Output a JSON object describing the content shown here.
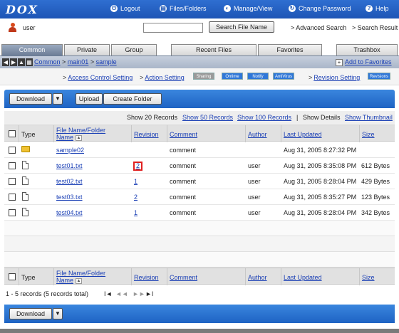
{
  "app": {
    "logo": "DOX"
  },
  "topnav": [
    {
      "icon": "logout-icon",
      "glyph": "⏻",
      "label": "Logout"
    },
    {
      "icon": "files-folders-icon",
      "glyph": "▤",
      "label": "Files/Folders"
    },
    {
      "icon": "manage-view-icon",
      "glyph": "◐",
      "label": "Manage/View"
    },
    {
      "icon": "change-password-icon",
      "glyph": "↻",
      "label": "Change Password"
    },
    {
      "icon": "help-icon",
      "glyph": "?",
      "label": "Help"
    }
  ],
  "user": {
    "name": "user"
  },
  "search": {
    "value": "",
    "button": "Search File Name",
    "advanced": "Advanced Search",
    "results": "Search Result"
  },
  "tabs": [
    "Common",
    "Private",
    "Group",
    "Recent Files",
    "Favorites",
    "Trashbox"
  ],
  "path": {
    "crumbs": [
      "Common",
      "main01",
      "sample"
    ],
    "add_favorites": "Add to Favorites"
  },
  "settings": {
    "access": "Access Control Setting",
    "action": "Action Setting",
    "badges": [
      "Sharing",
      "Ontime",
      "Notify",
      "AntiVirus"
    ],
    "revision": "Revision Setting",
    "revision_badge": "Revisions"
  },
  "toolbar": {
    "download": "Download",
    "upload": "Upload",
    "create_folder": "Create Folder"
  },
  "records_bar": {
    "show20": "Show 20 Records",
    "show50": "Show 50 Records",
    "show100": "Show 100 Records",
    "divider": "|",
    "details": "Show Details",
    "thumbnail": "Show Thumbnail"
  },
  "columns": {
    "type": "Type",
    "name_line1": "File Name/Folder",
    "name_line2": "Name",
    "revision": "Revision",
    "comment": "Comment",
    "author": "Author",
    "updated": "Last Updated",
    "size": "Size"
  },
  "rows": [
    {
      "kind": "folder",
      "name": "sample02",
      "revision": "",
      "comment": "comment",
      "author": "",
      "updated": "Aug 31, 2005 8:27:32 PM",
      "size": ""
    },
    {
      "kind": "file",
      "name": "test01.txt",
      "revision": "2",
      "comment": "comment",
      "author": "user",
      "updated": "Aug 31, 2005 8:35:08 PM",
      "size": "612 Bytes"
    },
    {
      "kind": "file",
      "name": "test02.txt",
      "revision": "1",
      "comment": "comment",
      "author": "user",
      "updated": "Aug 31, 2005 8:28:04 PM",
      "size": "429 Bytes"
    },
    {
      "kind": "file",
      "name": "test03.txt",
      "revision": "2",
      "comment": "comment",
      "author": "user",
      "updated": "Aug 31, 2005 8:35:27 PM",
      "size": "123 Bytes"
    },
    {
      "kind": "file",
      "name": "test04.txt",
      "revision": "1",
      "comment": "comment",
      "author": "user",
      "updated": "Aug 31, 2005 8:28:04 PM",
      "size": "342 Bytes"
    }
  ],
  "pager": {
    "summary": "1 - 5 records (5 records total)",
    "first": "I◄",
    "prev": "◄◄",
    "next": "►►",
    "last": "►I"
  }
}
